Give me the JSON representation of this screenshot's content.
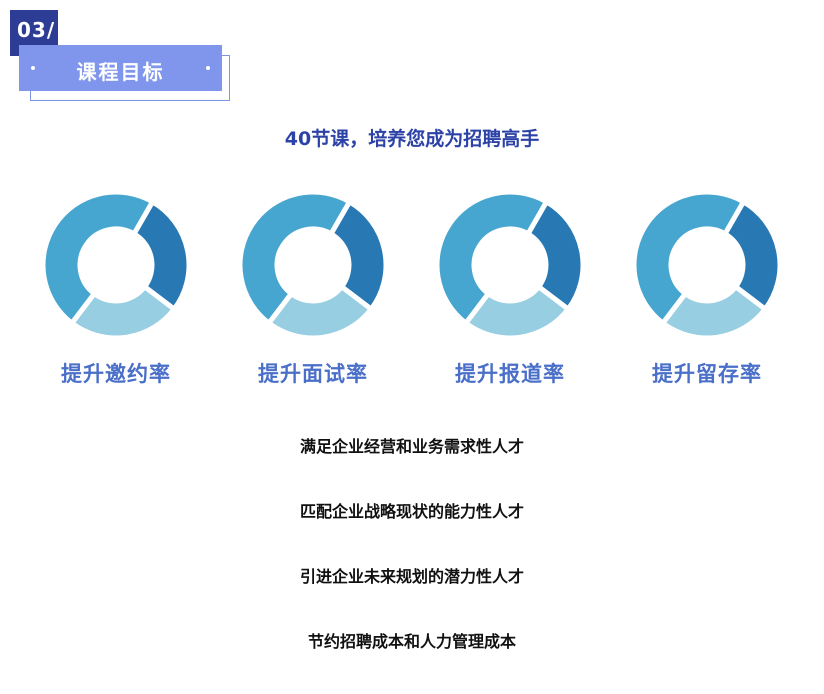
{
  "header": {
    "section_number": "03/",
    "title": "课程目标"
  },
  "subtitle": "40节课，培养您成为招聘高手",
  "donut_colors": {
    "dark": "#2878b4",
    "mid": "#47a6cf",
    "light": "#97cee2"
  },
  "donut_segments": [
    0.27,
    0.25,
    0.48
  ],
  "goals": [
    {
      "label": "提升邀约率"
    },
    {
      "label": "提升面试率"
    },
    {
      "label": "提升报道率"
    },
    {
      "label": "提升留存率"
    }
  ],
  "objectives": [
    "满足企业经营和业务需求性人才",
    "匹配企业战略现状的能力性人才",
    "引进企业未来规划的潜力性人才",
    "节约招聘成本和人力管理成本"
  ]
}
